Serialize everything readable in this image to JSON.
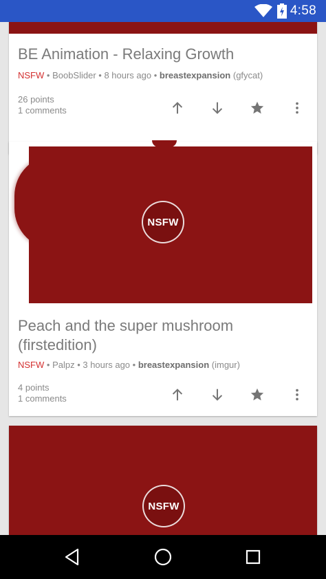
{
  "status_bar": {
    "time": "4:58",
    "wifi_icon": "wifi-icon",
    "battery_icon": "battery-icon"
  },
  "posts": [
    {
      "title": "BE Animation - Relaxing Growth",
      "nsfw_label": "NSFW",
      "meta": "• BoobSlider • 8 hours ago •",
      "subreddit": "breastexpansion",
      "domain": "(gfycat)",
      "points": "26 points",
      "comments": "1 comments"
    },
    {
      "title": "Peach and the super mushroom (firstedition)",
      "badge": "NSFW",
      "nsfw_label": "NSFW",
      "meta": "• Palpz • 3 hours ago •",
      "subreddit": "breastexpansion",
      "domain": "(imgur)",
      "points": "4 points",
      "comments": "1 comments"
    },
    {
      "badge": "NSFW"
    }
  ],
  "colors": {
    "status_bar": "#2a56c6",
    "thumbnail": "#8b1414",
    "nsfw": "#d32f2f"
  }
}
